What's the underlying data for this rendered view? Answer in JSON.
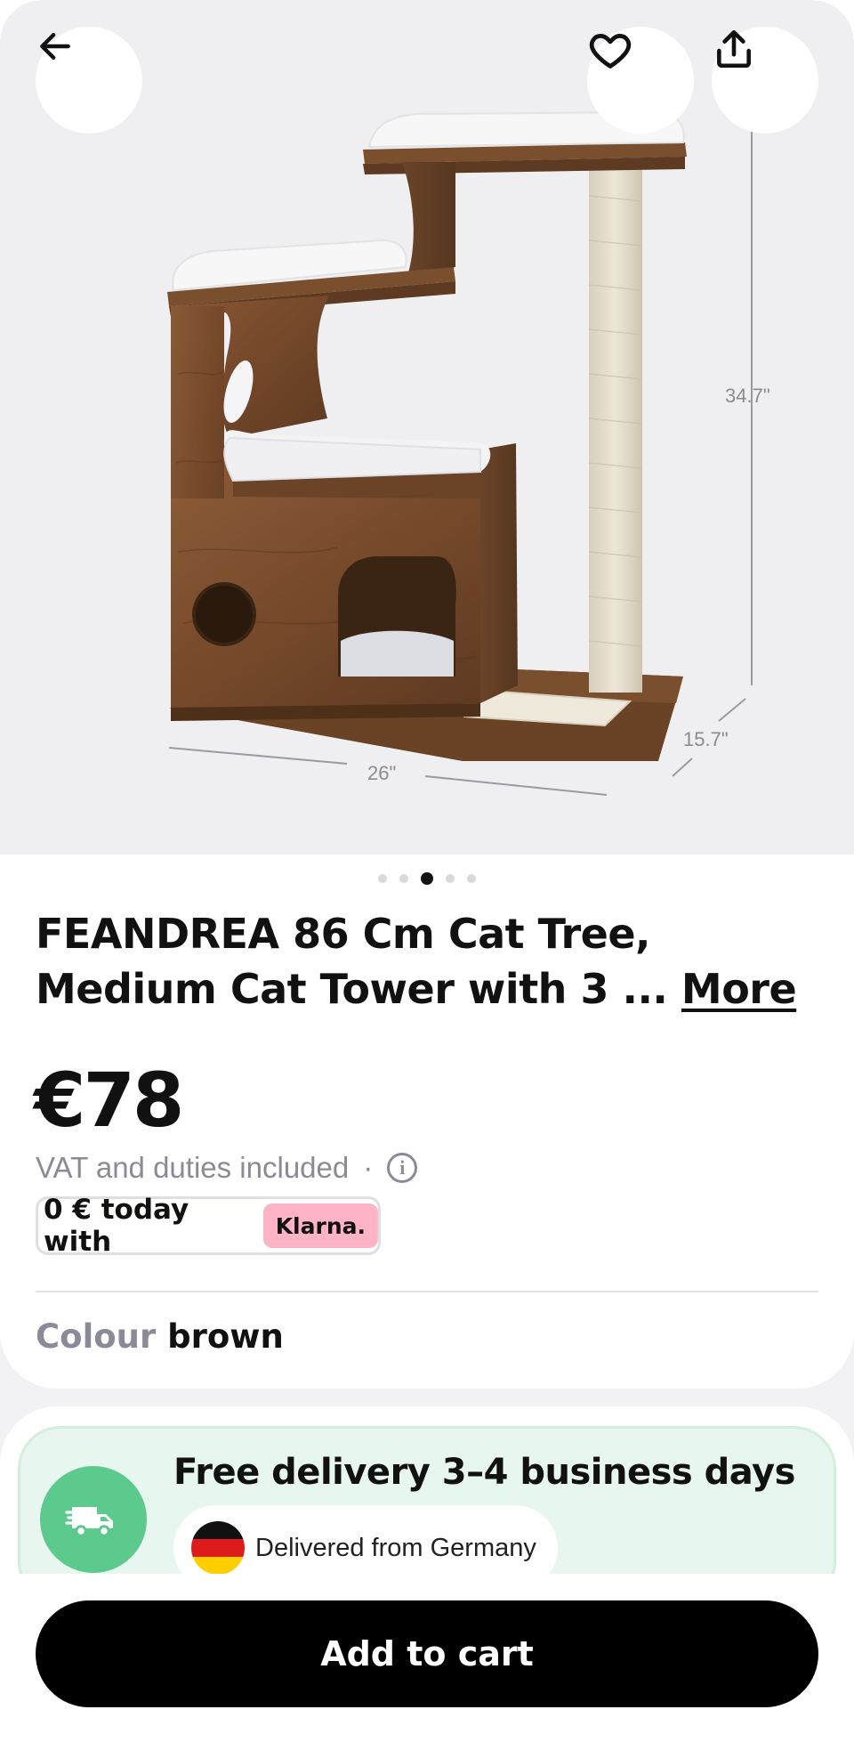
{
  "hero": {
    "image_alt": "Cat tree product photo",
    "dimensions": {
      "height": "34.7\"",
      "width": "26\"",
      "depth": "15.7\""
    },
    "carousel": {
      "count": 5,
      "active_index": 2
    }
  },
  "header": {
    "back_icon": "arrow-left-icon",
    "favorite_icon": "heart-icon",
    "share_icon": "share-icon"
  },
  "product": {
    "title_line1": "FEANDREA 86 Cm Cat Tree,",
    "title_line2": "Medium Cat Tower with 3 ... ",
    "more_label": "More",
    "price": "€78",
    "vat_text": "VAT and duties included",
    "vat_separator": "·",
    "info_icon": "info-icon",
    "klarna_text": "0 € today with",
    "klarna_badge": "Klarna.",
    "colour_label": "Colour",
    "colour_value": "brown"
  },
  "delivery": {
    "title": "Free delivery 3–4 business days",
    "from_text": "Delivered from Germany",
    "truck_icon": "truck-icon",
    "flag_icon": "germany-flag-icon",
    "accent": "#5cc98d"
  },
  "cart": {
    "add_label": "Add to cart"
  },
  "colors": {
    "brand_dark": "#000000",
    "muted": "#8b8b98",
    "klarna_pink": "#ffb3c7"
  }
}
